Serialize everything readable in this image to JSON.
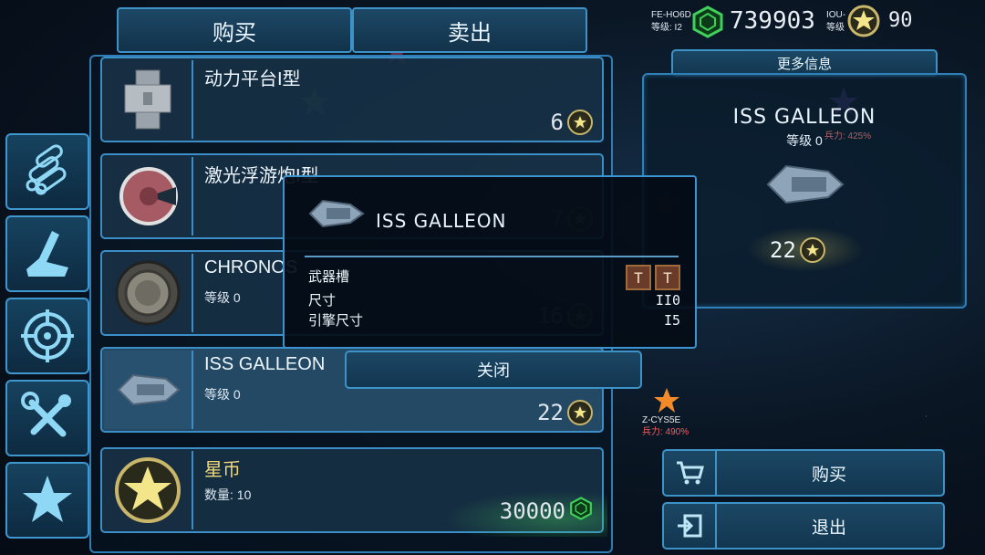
{
  "tabs": {
    "buy": "购买",
    "sell": "卖出"
  },
  "currency": {
    "green_amount": "739903",
    "star_amount": "90",
    "green_icon": "green-crystal-icon",
    "star_icon": "star-coin-icon"
  },
  "map_labels": {
    "top_left": {
      "code": "FE-HO6D",
      "level": "等级: I2"
    },
    "top_right": {
      "code": "IOU-",
      "level": "等级"
    },
    "right_marker": {
      "code": "Z-CYS5E",
      "power": "兵力: 490%"
    },
    "info_power": "兵力: 425%"
  },
  "nav_icons": [
    "cylinders-icon",
    "hull-icon",
    "target-icon",
    "tools-icon",
    "star-icon"
  ],
  "items": [
    {
      "name": "动力平台I型",
      "level": "",
      "price": "6",
      "currency": "star"
    },
    {
      "name": "激光浮游炮I型",
      "level": "",
      "price": "7",
      "currency": "star"
    },
    {
      "name": "CHRONOS",
      "level": "等级 0",
      "price": "16",
      "currency": "star"
    },
    {
      "name": "ISS GALLEON",
      "level": "等级 0",
      "price": "22",
      "currency": "star"
    },
    {
      "name": "星币",
      "level": "数量: 10",
      "price": "30000",
      "currency": "green"
    }
  ],
  "info_panel": {
    "header": "更多信息",
    "ship_name": "ISS GALLEON",
    "level": "等级 0",
    "price": "22"
  },
  "popup": {
    "title": "ISS GALLEON",
    "rows": [
      {
        "label": "武器槽",
        "value": ""
      },
      {
        "label": "尺寸",
        "value": "II0"
      },
      {
        "label": "引擎尺寸",
        "value": "I5"
      }
    ],
    "slots": [
      "T",
      "T"
    ],
    "close": "关闭"
  },
  "actions": {
    "buy": "购买",
    "exit": "退出"
  },
  "colors": {
    "accent": "#3d92c8",
    "gold": "#d8c070",
    "green": "#3fcf5a"
  }
}
